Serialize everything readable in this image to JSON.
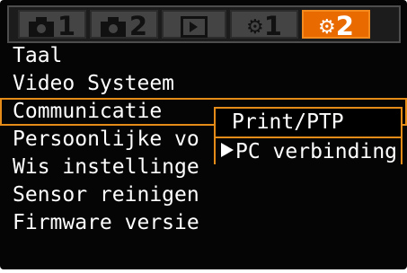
{
  "tabs": [
    {
      "label": "1",
      "icon": "shooting-camera-icon"
    },
    {
      "label": "2",
      "icon": "shooting-camera-icon"
    },
    {
      "label": "",
      "icon": "playback-icon"
    },
    {
      "label": "1",
      "icon": "setup-tool-icon"
    },
    {
      "label": "2",
      "icon": "setup-tool-icon",
      "active": true
    }
  ],
  "menu": {
    "items": [
      "Taal",
      "Video Systeem",
      "Communicatie",
      "Persoonlijke vo",
      "Wis instellinge",
      "Sensor reinigen",
      "Firmware versie"
    ],
    "selected_index": 2
  },
  "submenu": {
    "options": [
      "Print/PTP",
      "PC verbinding"
    ],
    "selected_index": 1
  },
  "colors": {
    "accent": "#e96b00",
    "highlight": "#e58c18",
    "background": "#050505"
  }
}
